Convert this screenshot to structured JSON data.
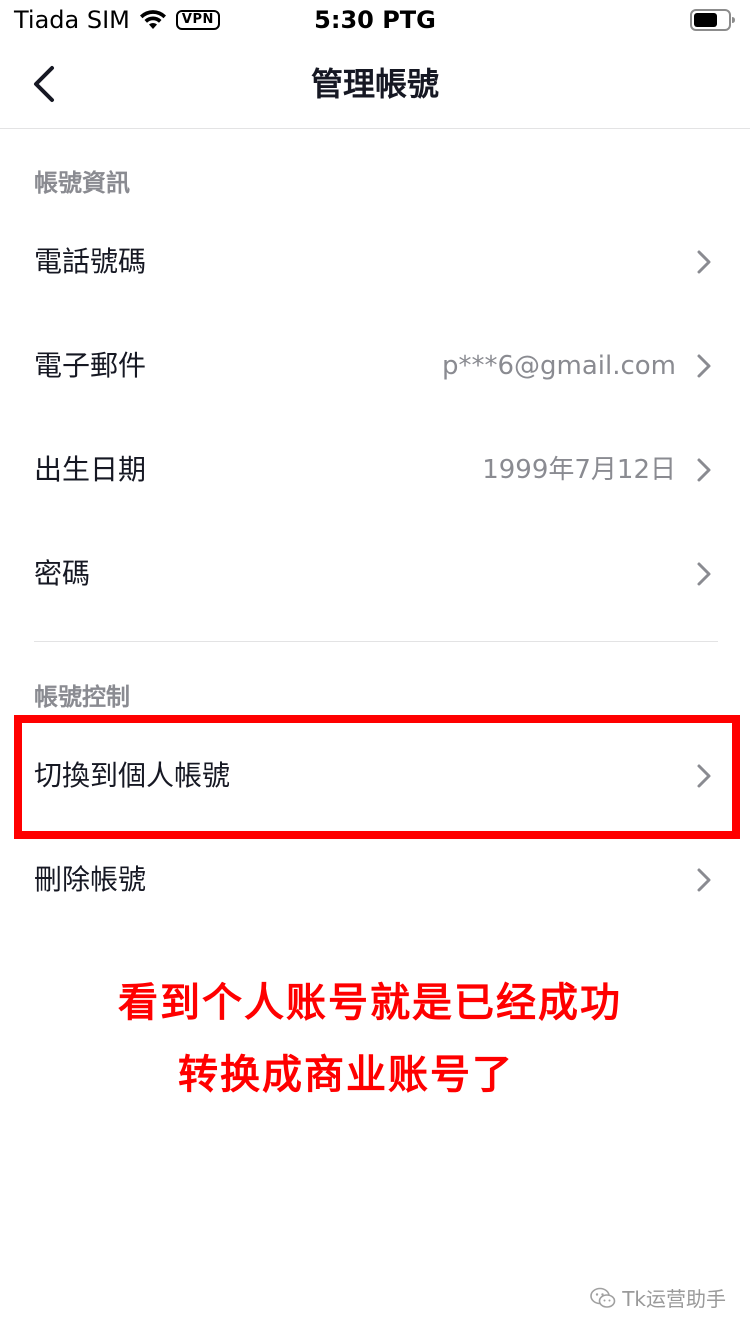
{
  "status_bar": {
    "carrier": "Tiada SIM",
    "vpn": "VPN",
    "time": "5:30 PTG"
  },
  "nav": {
    "title": "管理帳號"
  },
  "sections": {
    "account_info": {
      "header": "帳號資訊",
      "rows": [
        {
          "label": "電話號碼",
          "value": ""
        },
        {
          "label": "電子郵件",
          "value": "p***6@gmail.com"
        },
        {
          "label": "出生日期",
          "value": "1999年7月12日"
        },
        {
          "label": "密碼",
          "value": ""
        }
      ]
    },
    "account_control": {
      "header": "帳號控制",
      "rows": [
        {
          "label": "切換到個人帳號"
        },
        {
          "label": "刪除帳號"
        }
      ]
    }
  },
  "annotation": {
    "line1": "看到个人账号就是已经成功",
    "line2": "转换成商业账号了",
    "color": "#ff0000"
  },
  "watermark": {
    "text": "Tk运营助手"
  },
  "colors": {
    "primary_text": "#161823",
    "secondary_text": "#8a8b91",
    "divider": "#e3e3e4",
    "highlight": "#ff0000"
  }
}
